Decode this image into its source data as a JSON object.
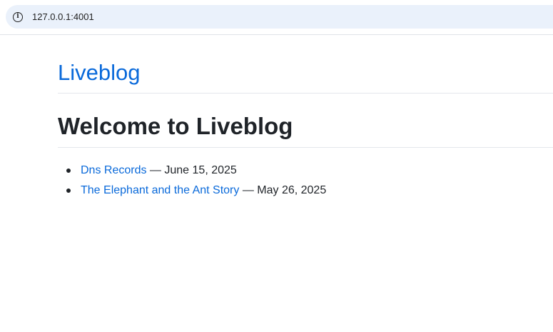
{
  "browser": {
    "url": "127.0.0.1:4001",
    "info_icon": "info-icon"
  },
  "site": {
    "title": "Liveblog"
  },
  "main": {
    "heading": "Welcome to Liveblog",
    "separator": " — ",
    "posts": [
      {
        "title": "Dns Records",
        "date": "June 15, 2025"
      },
      {
        "title": "The Elephant and the Ant Story",
        "date": "May 26, 2025"
      }
    ]
  },
  "colors": {
    "link": "#0969da",
    "text": "#1f2328",
    "address_bar": "#eaf1fb"
  }
}
